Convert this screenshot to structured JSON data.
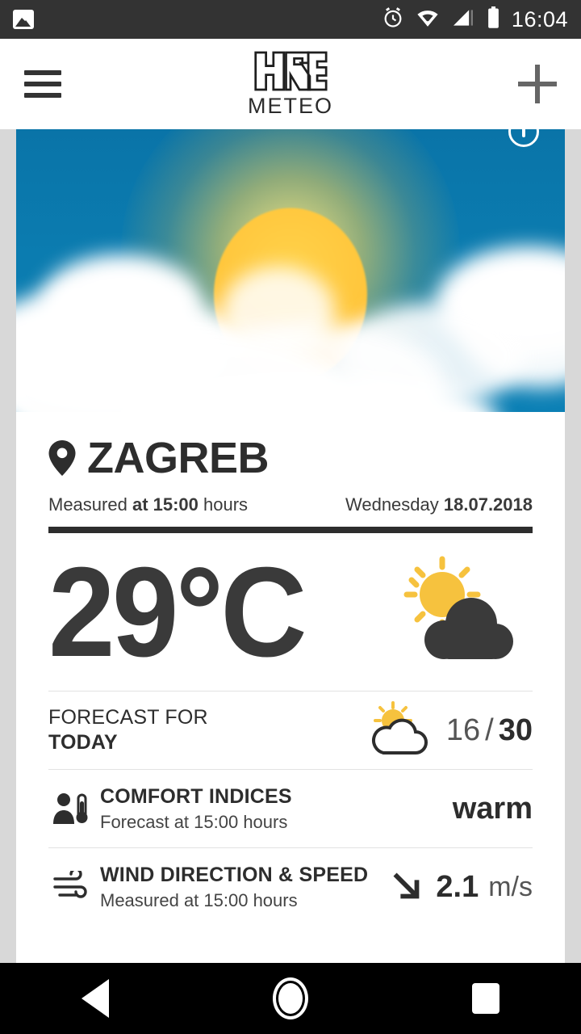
{
  "statusbar": {
    "time": "16:04",
    "icons": [
      "gallery-icon",
      "alarm-icon",
      "wifi-icon",
      "signal-icon",
      "battery-icon"
    ]
  },
  "appbar": {
    "menu_icon": "hamburger-menu-icon",
    "logo_primary": "HRT",
    "logo_secondary": "METEO",
    "add_icon": "plus-icon"
  },
  "hero": {
    "image_alt": "sun-behind-clouds-photo",
    "info_icon": "info-icon",
    "sky_color": "#0c7cb0",
    "sun_color": "#ffc63c"
  },
  "location": {
    "pin_icon": "location-pin-icon",
    "city": "ZAGREB",
    "measured_prefix": "Measured ",
    "measured_time": "at 15:00",
    "measured_suffix": " hours",
    "weekday": "Wednesday ",
    "date": "18.07.2018"
  },
  "current": {
    "temperature": "29°C",
    "condition_icon": "sun-behind-cloud-icon"
  },
  "forecast": {
    "label_top": "FORECAST FOR",
    "label_bottom": "TODAY",
    "icon": "sun-behind-cloud-outline-icon",
    "min": "16",
    "separator": " / ",
    "max": "30"
  },
  "comfort": {
    "icon": "person-thermometer-icon",
    "title": "COMFORT INDICES",
    "subtitle": "Forecast at 15:00 hours",
    "value": "warm"
  },
  "wind": {
    "icon": "wind-lines-icon",
    "title": "WIND DIRECTION & SPEED",
    "subtitle": "Measured at 15:00 hours",
    "direction_icon": "arrow-down-right-icon",
    "speed": "2.1",
    "unit": "m/s"
  },
  "navbar": {
    "back": "back-icon",
    "home": "home-icon",
    "recents": "recents-icon"
  }
}
